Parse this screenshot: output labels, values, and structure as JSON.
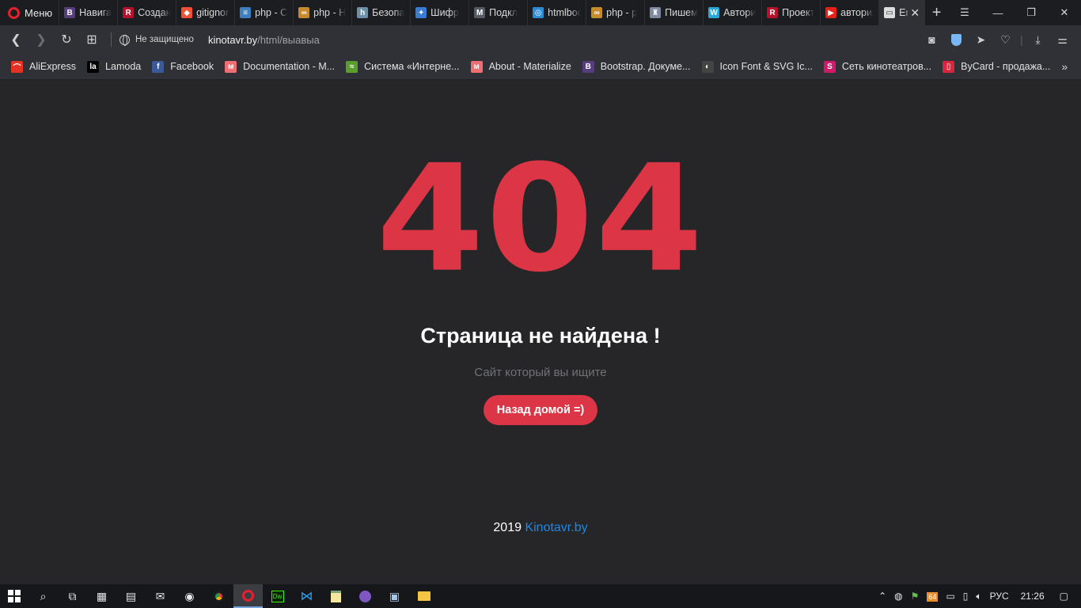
{
  "browser": {
    "menu_label": "Меню",
    "tabs": [
      {
        "label": "Навига",
        "icon": "bootstrap-icon",
        "color": "#563d7c",
        "glyph": "B"
      },
      {
        "label": "Создан",
        "icon": "r-icon",
        "color": "#b3122a",
        "glyph": "R"
      },
      {
        "label": "gitignore",
        "icon": "git-icon",
        "color": "#f05033",
        "glyph": "◆"
      },
      {
        "label": "php - Сравнение",
        "icon": "stackoverflow-icon",
        "color": "#3f7fc0",
        "glyph": "≡"
      },
      {
        "label": "php - Н",
        "icon": "glasses-icon",
        "color": "#c58b2c",
        "glyph": "∞"
      },
      {
        "label": "Безопа",
        "icon": "habr-icon",
        "color": "#6d8fa8",
        "glyph": "h"
      },
      {
        "label": "Шифр",
        "icon": "network-icon",
        "color": "#3a7bd5",
        "glyph": "✦"
      },
      {
        "label": "Подкл",
        "icon": "m-icon",
        "color": "#555a66",
        "glyph": "M"
      },
      {
        "label": "htmlbook",
        "icon": "globe-icon",
        "color": "#2d8cd6",
        "glyph": "◎"
      },
      {
        "label": "php - р",
        "icon": "glasses-icon",
        "color": "#c58b2c",
        "glyph": "∞"
      },
      {
        "label": "Пишем",
        "icon": "castle-icon",
        "color": "#7d8aa0",
        "glyph": "♜"
      },
      {
        "label": "Автори",
        "icon": "w-icon",
        "color": "#2aa7d8",
        "glyph": "W"
      },
      {
        "label": "Проект",
        "icon": "r-icon",
        "color": "#b3122a",
        "glyph": "R"
      },
      {
        "label": "авторизация",
        "icon": "youtube-icon",
        "color": "#e62117",
        "glyph": "▶"
      }
    ],
    "active_tab": {
      "label": "Error",
      "icon": "page-icon"
    },
    "security_label": "Не защищено",
    "url_domain": "kinotavr.by",
    "url_path": "/html/выавыа"
  },
  "bookmarks": [
    {
      "label": "AliExpress",
      "icon": "aliexpress-icon",
      "color": "#e43225",
      "glyph": "⌒"
    },
    {
      "label": "Lamoda",
      "icon": "lamoda-icon",
      "color": "#000000",
      "glyph": "la"
    },
    {
      "label": "Facebook",
      "icon": "facebook-icon",
      "color": "#3b5998",
      "glyph": "f"
    },
    {
      "label": "Documentation - M...",
      "icon": "materialize-icon",
      "color": "#ee6e73",
      "glyph": "ᴍ"
    },
    {
      "label": "Система «Интерне...",
      "icon": "rss-icon",
      "color": "#5a9e2c",
      "glyph": "≈"
    },
    {
      "label": "About - Materialize",
      "icon": "materialize-icon",
      "color": "#ee6e73",
      "glyph": "ᴍ"
    },
    {
      "label": "Bootstrap. Докуме...",
      "icon": "bootstrap-icon",
      "color": "#563d7c",
      "glyph": "B"
    },
    {
      "label": "Icon Font & SVG Ic...",
      "icon": "iconfont-icon",
      "color": "#444444",
      "glyph": "◐"
    },
    {
      "label": "Сеть кинотеатров...",
      "icon": "cinema-icon",
      "color": "#d0196b",
      "glyph": "S"
    },
    {
      "label": "ByCard - продажа...",
      "icon": "bycard-icon",
      "color": "#d7263d",
      "glyph": "▯"
    }
  ],
  "page": {
    "code": "404",
    "title": "Страница не найдена !",
    "subtitle": "Сайт который вы ищите",
    "button_label": "Назад домой =)",
    "footer_year": "2019",
    "footer_link": "Kinotavr.by"
  },
  "colors": {
    "accent": "#dc3545",
    "background": "#262629",
    "link": "#1e88e5"
  },
  "taskbar": {
    "language": "РУС",
    "time": "21:26",
    "apps": [
      "search-icon",
      "task-view-icon",
      "calendar-icon",
      "calculator-icon",
      "mail-icon",
      "media-icon",
      "chrome-icon",
      "opera-icon",
      "dreamweaver-icon",
      "vscode-icon",
      "notepad-icon",
      "discord-icon",
      "network-icon",
      "folder-icon"
    ]
  }
}
